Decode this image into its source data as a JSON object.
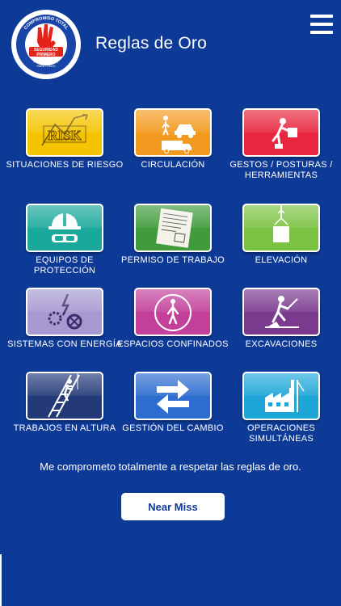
{
  "header": {
    "title": "Reglas de Oro",
    "logo": {
      "top_text": "COMPROMISO TOTAL",
      "main_text": "SEGURIDAD PRIMERO",
      "bottom_text": "PARA MÍ, PARA TI, PARA TODOS",
      "icon": "three-fingers-hand-icon"
    },
    "menu_icon": "hamburger-menu-icon"
  },
  "rules": [
    {
      "label": "SITUACIONES DE RIESGO",
      "icon": "risk-icon",
      "color": "#f5c400",
      "icon_text": "RISK"
    },
    {
      "label": "CIRCULACIÓN",
      "icon": "traffic-circulation-icon",
      "color": "#f29a1f"
    },
    {
      "label": "GESTOS / POSTURAS / HERRAMIENTAS",
      "icon": "lifting-posture-icon",
      "color": "#e8263f"
    },
    {
      "label": "EQUIPOS DE PROTECCIÓN",
      "icon": "protective-equipment-icon",
      "color": "#1aa89a"
    },
    {
      "label": "PERMISO DE TRABAJO",
      "icon": "work-permit-icon",
      "color": "#3f9b3c"
    },
    {
      "label": "ELEVACIÓN",
      "icon": "crane-lift-icon",
      "color": "#7cc242"
    },
    {
      "label": "SISTEMAS CON ENERGÍA",
      "icon": "energy-systems-icon",
      "color": "#a79ad1"
    },
    {
      "label": "ESPACIOS CONFINADOS",
      "icon": "confined-space-icon",
      "color": "#c2409a"
    },
    {
      "label": "EXCAVACIONES",
      "icon": "excavation-icon",
      "color": "#7a3b8e"
    },
    {
      "label": "TRABAJOS EN ALTURA",
      "icon": "work-at-height-icon",
      "color": "#243a78"
    },
    {
      "label": "GESTIÓN DEL CAMBIO",
      "icon": "change-management-icon",
      "color": "#2d6dcf"
    },
    {
      "label": "OPERACIONES SIMULTÁNEAS",
      "icon": "simultaneous-operations-icon",
      "color": "#1fa6d8"
    }
  ],
  "statement": "Me comprometo totalmente a respetar las reglas de oro.",
  "near_miss_button": "Near Miss"
}
